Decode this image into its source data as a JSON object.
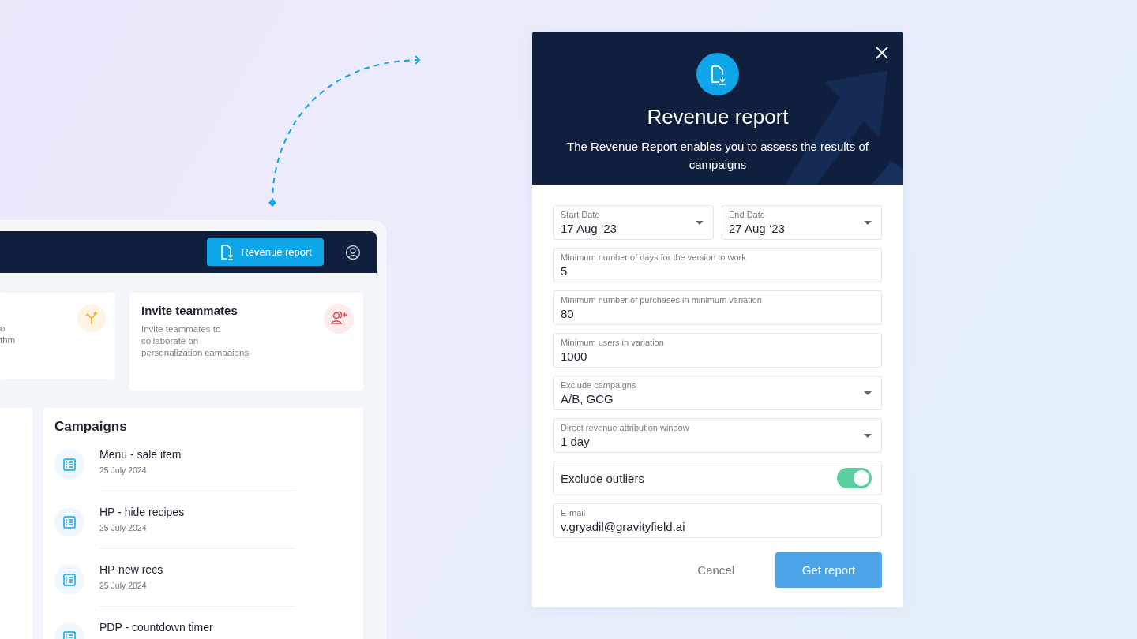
{
  "app": {
    "header_button": "Revenue report",
    "cards": [
      {
        "kind": "partial",
        "lines": [
          "o",
          "thm"
        ]
      },
      {
        "kind": "full",
        "title": "Invite teammates",
        "text": "Invite teammates to collaborate on personalization campaigns"
      }
    ],
    "campaigns": {
      "title": "Campaigns",
      "items": [
        {
          "name": "Menu - sale item",
          "date": "25 July 2024"
        },
        {
          "name": "HP - hide recipes",
          "date": "25 July 2024"
        },
        {
          "name": "HP-new recs",
          "date": "25 July 2024"
        },
        {
          "name": "PDP - countdown timer"
        }
      ]
    }
  },
  "dialog": {
    "title": "Revenue report",
    "description": "The Revenue Report enables you to assess the results of campaigns",
    "fields": [
      {
        "kind": "dropdown",
        "half": true,
        "label": "Start Date",
        "value": "17 Aug ‘23"
      },
      {
        "kind": "dropdown",
        "half": true,
        "label": "End Date",
        "value": "27 Aug ‘23"
      },
      {
        "kind": "text",
        "label": "Minimum number of days for the version to work",
        "value": "5"
      },
      {
        "kind": "text",
        "label": "Minimum number of purchases in minimum variation",
        "value": "80"
      },
      {
        "kind": "text",
        "label": "Minimum users in variation",
        "value": "1000"
      },
      {
        "kind": "dropdown",
        "label": "Exclude campaigns",
        "value": "A/B, GCG"
      },
      {
        "kind": "dropdown",
        "label": "Direct revenue attribution window",
        "value": "1 day"
      },
      {
        "kind": "toggle",
        "label": "Exclude outliers",
        "on": true
      },
      {
        "kind": "text",
        "label": "E-mail",
        "value": "v.gryadil@gravityfield.ai"
      }
    ],
    "buttons": [
      {
        "kind": "text",
        "label": "Cancel"
      },
      {
        "kind": "primary",
        "label": "Get report"
      }
    ]
  }
}
